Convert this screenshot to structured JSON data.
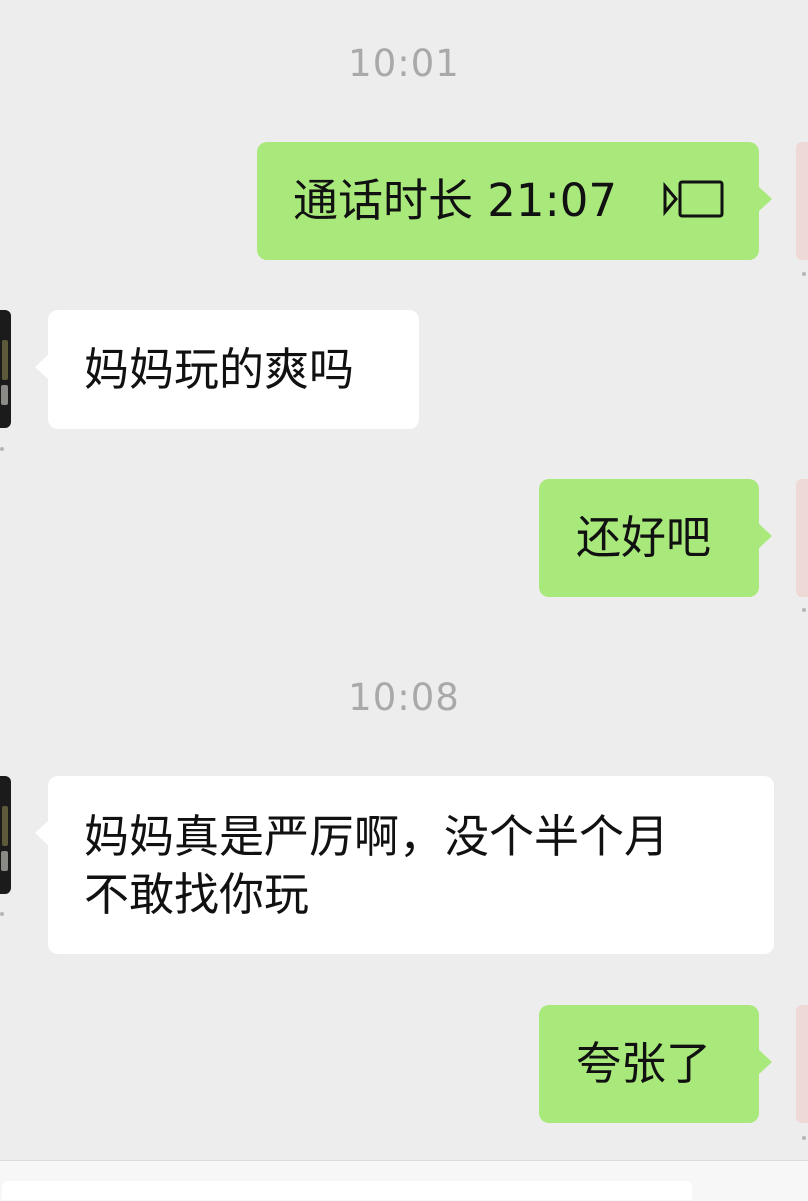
{
  "messages": [
    {
      "type": "time",
      "text": "10:01"
    },
    {
      "type": "out",
      "text": "通话时长 21:07",
      "icon": "video-call-icon"
    },
    {
      "type": "in",
      "text": "妈妈玩的爽吗"
    },
    {
      "type": "out",
      "text": "还好吧"
    },
    {
      "type": "time",
      "text": "10:08"
    },
    {
      "type": "in",
      "lines": [
        "妈妈真是严厉啊，没个半个月",
        "不敢找你玩"
      ]
    },
    {
      "type": "out",
      "text": "夸张了"
    }
  ],
  "colors": {
    "background": "#ededed",
    "outgoing": "#a9e97b",
    "incoming": "#ffffff",
    "timestamp": "#a9a9a9"
  }
}
